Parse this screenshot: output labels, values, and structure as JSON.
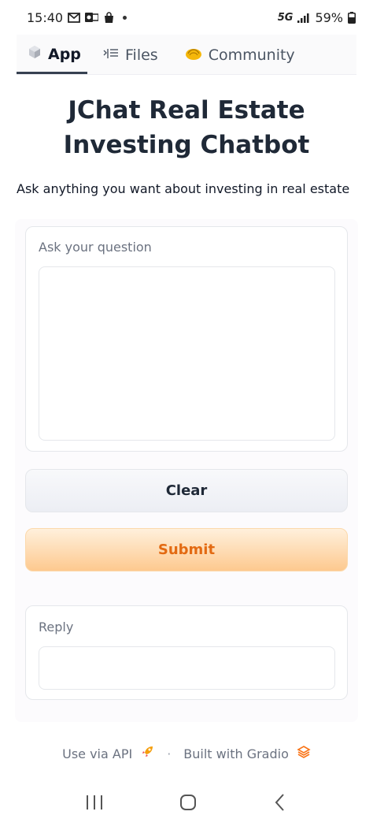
{
  "status_bar": {
    "time": "15:40",
    "network": "5G",
    "battery": "59%"
  },
  "tabs": [
    {
      "label": "App",
      "icon": "cube-icon",
      "active": true
    },
    {
      "label": "Files",
      "icon": "files-icon",
      "active": false
    },
    {
      "label": "Community",
      "icon": "community-icon",
      "active": false
    }
  ],
  "page": {
    "title": "JChat Real Estate Investing Chatbot",
    "description": "Ask anything you want about investing in real estate"
  },
  "question": {
    "label": "Ask your question",
    "value": ""
  },
  "buttons": {
    "clear": "Clear",
    "submit": "Submit"
  },
  "reply": {
    "label": "Reply",
    "value": ""
  },
  "footer": {
    "api_link": "Use via API",
    "separator": "·",
    "built_with": "Built with Gradio"
  },
  "colors": {
    "submit_text": "#e36a12",
    "submit_bg": "#fdc98f",
    "title": "#1f2937"
  }
}
